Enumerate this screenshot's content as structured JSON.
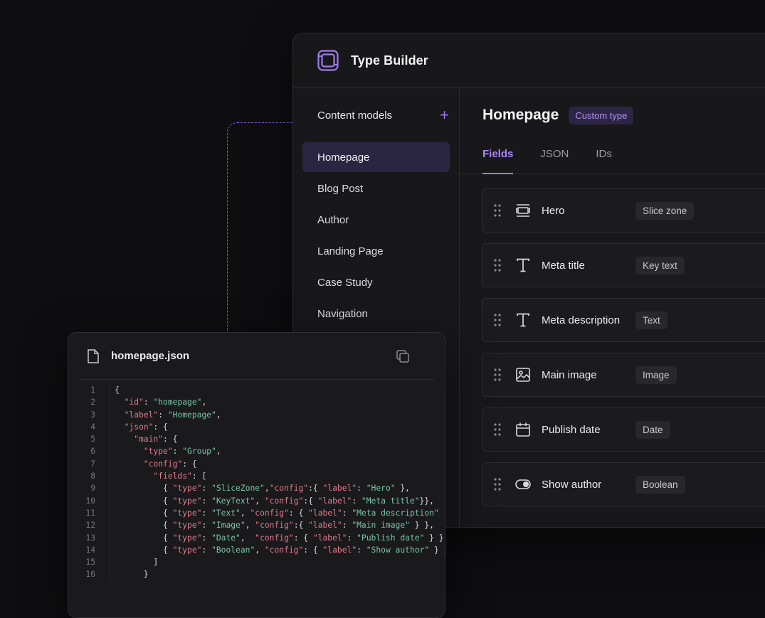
{
  "app": {
    "title": "Type Builder"
  },
  "sidebar": {
    "header": "Content models",
    "items": [
      {
        "label": "Homepage",
        "active": true
      },
      {
        "label": "Blog Post"
      },
      {
        "label": "Author"
      },
      {
        "label": "Landing Page"
      },
      {
        "label": "Case Study"
      },
      {
        "label": "Navigation"
      }
    ]
  },
  "content": {
    "title": "Homepage",
    "badge": "Custom type",
    "tabs": [
      {
        "label": "Fields",
        "active": true
      },
      {
        "label": "JSON"
      },
      {
        "label": "IDs"
      }
    ],
    "fields": [
      {
        "label": "Hero",
        "type": "Slice zone",
        "icon": "slice-zone-icon"
      },
      {
        "label": "Meta title",
        "type": "Key text",
        "icon": "text-icon"
      },
      {
        "label": "Meta description",
        "type": "Text",
        "icon": "text-icon"
      },
      {
        "label": "Main image",
        "type": "Image",
        "icon": "image-icon"
      },
      {
        "label": "Publish date",
        "type": "Date",
        "icon": "calendar-icon"
      },
      {
        "label": "Show author",
        "type": "Boolean",
        "icon": "toggle-icon"
      }
    ]
  },
  "json_panel": {
    "filename": "homepage.json",
    "lines": [
      {
        "n": "1",
        "segs": [
          [
            "p",
            "{"
          ]
        ]
      },
      {
        "n": "2",
        "segs": [
          [
            "p",
            "  "
          ],
          [
            "k",
            "\"id\""
          ],
          [
            "p",
            ": "
          ],
          [
            "s",
            "\"homepage\""
          ],
          [
            "p",
            ","
          ]
        ]
      },
      {
        "n": "3",
        "segs": [
          [
            "p",
            "  "
          ],
          [
            "k",
            "\"label\""
          ],
          [
            "p",
            ": "
          ],
          [
            "s",
            "\"Homepage\""
          ],
          [
            "p",
            ","
          ]
        ]
      },
      {
        "n": "4",
        "segs": [
          [
            "p",
            "  "
          ],
          [
            "k",
            "\"json\""
          ],
          [
            "p",
            ": {"
          ]
        ]
      },
      {
        "n": "5",
        "segs": [
          [
            "p",
            "    "
          ],
          [
            "k",
            "\"main\""
          ],
          [
            "p",
            ": {"
          ]
        ]
      },
      {
        "n": "6",
        "segs": [
          [
            "p",
            "      "
          ],
          [
            "k",
            "\"type\""
          ],
          [
            "p",
            ": "
          ],
          [
            "s",
            "\"Group\""
          ],
          [
            "p",
            ","
          ]
        ]
      },
      {
        "n": "7",
        "segs": [
          [
            "p",
            "      "
          ],
          [
            "k",
            "\"config\""
          ],
          [
            "p",
            ": {"
          ]
        ]
      },
      {
        "n": "8",
        "segs": [
          [
            "p",
            "        "
          ],
          [
            "k",
            "\"fields\""
          ],
          [
            "p",
            ": ["
          ]
        ]
      },
      {
        "n": "9",
        "segs": [
          [
            "p",
            "          { "
          ],
          [
            "k",
            "\"type\""
          ],
          [
            "p",
            ": "
          ],
          [
            "s",
            "\"SliceZone\""
          ],
          [
            "p",
            ","
          ],
          [
            "k",
            "\"config\""
          ],
          [
            "p",
            ":{ "
          ],
          [
            "k",
            "\"label\""
          ],
          [
            "p",
            ": "
          ],
          [
            "s",
            "\"Hero\""
          ],
          [
            "p",
            " },"
          ]
        ]
      },
      {
        "n": "10",
        "segs": [
          [
            "p",
            "          { "
          ],
          [
            "k",
            "\"type\""
          ],
          [
            "p",
            ": "
          ],
          [
            "s",
            "\"KeyText\""
          ],
          [
            "p",
            ", "
          ],
          [
            "k",
            "\"config\""
          ],
          [
            "p",
            ":{ "
          ],
          [
            "k",
            "\"label\""
          ],
          [
            "p",
            ": "
          ],
          [
            "s",
            "\"Meta title\""
          ],
          [
            "p",
            "}},"
          ]
        ]
      },
      {
        "n": "11",
        "segs": [
          [
            "p",
            "          { "
          ],
          [
            "k",
            "\"type\""
          ],
          [
            "p",
            ": "
          ],
          [
            "s",
            "\"Text\""
          ],
          [
            "p",
            ", "
          ],
          [
            "k",
            "\"config\""
          ],
          [
            "p",
            ": { "
          ],
          [
            "k",
            "\"label\""
          ],
          [
            "p",
            ": "
          ],
          [
            "s",
            "\"Meta description\""
          ],
          [
            "p",
            " },"
          ]
        ]
      },
      {
        "n": "12",
        "segs": [
          [
            "p",
            "          { "
          ],
          [
            "k",
            "\"type\""
          ],
          [
            "p",
            ": "
          ],
          [
            "s",
            "\"Image\""
          ],
          [
            "p",
            ", "
          ],
          [
            "k",
            "\"config\""
          ],
          [
            "p",
            ":{ "
          ],
          [
            "k",
            "\"label\""
          ],
          [
            "p",
            ": "
          ],
          [
            "s",
            "\"Main image\""
          ],
          [
            "p",
            " } },"
          ]
        ]
      },
      {
        "n": "13",
        "segs": [
          [
            "p",
            "          { "
          ],
          [
            "k",
            "\"type\""
          ],
          [
            "p",
            ": "
          ],
          [
            "s",
            "\"Date\""
          ],
          [
            "p",
            ",  "
          ],
          [
            "k",
            "\"config\""
          ],
          [
            "p",
            ": { "
          ],
          [
            "k",
            "\"label\""
          ],
          [
            "p",
            ": "
          ],
          [
            "s",
            "\"Publish date\""
          ],
          [
            "p",
            " } },"
          ]
        ]
      },
      {
        "n": "14",
        "segs": [
          [
            "p",
            "          { "
          ],
          [
            "k",
            "\"type\""
          ],
          [
            "p",
            ": "
          ],
          [
            "s",
            "\"Boolean\""
          ],
          [
            "p",
            ", "
          ],
          [
            "k",
            "\"config\""
          ],
          [
            "p",
            ": { "
          ],
          [
            "k",
            "\"label\""
          ],
          [
            "p",
            ": "
          ],
          [
            "s",
            "\"Show author\""
          ],
          [
            "p",
            " } }"
          ]
        ]
      },
      {
        "n": "15",
        "segs": [
          [
            "p",
            "        ]"
          ]
        ]
      },
      {
        "n": "16",
        "segs": [
          [
            "p",
            "      }"
          ]
        ]
      }
    ]
  },
  "colors": {
    "accent": "#9d7bf0",
    "key": "#e07a8a",
    "string": "#79c6a3"
  }
}
